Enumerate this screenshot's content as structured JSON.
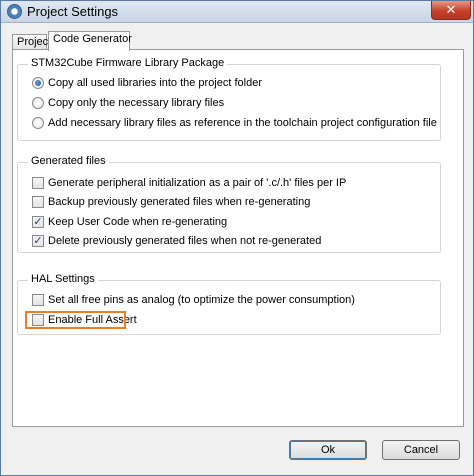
{
  "window": {
    "title": "Project Settings",
    "close_glyph": "✕"
  },
  "tabs": [
    {
      "label": "Project",
      "active": false
    },
    {
      "label": "Code Generator",
      "active": true
    }
  ],
  "firmware_group": {
    "title": "STM32Cube Firmware Library Package",
    "options": [
      {
        "label": "Copy all used libraries into the project folder",
        "selected": true
      },
      {
        "label": "Copy only the necessary library files",
        "selected": false
      },
      {
        "label": "Add necessary library files as reference in the toolchain project configuration file",
        "selected": false
      }
    ]
  },
  "generated_group": {
    "title": "Generated files",
    "options": [
      {
        "label": "Generate peripheral initialization as a pair of '.c/.h' files per IP",
        "checked": false
      },
      {
        "label": "Backup previously generated files when re-generating",
        "checked": false
      },
      {
        "label": "Keep User Code when re-generating",
        "checked": true
      },
      {
        "label": "Delete previously generated files when not re-generated",
        "checked": true
      }
    ]
  },
  "hal_group": {
    "title": "HAL Settings",
    "options": [
      {
        "label": "Set all free pins as analog (to optimize the power consumption)",
        "checked": false
      },
      {
        "label": "Enable Full Assert",
        "checked": false
      }
    ]
  },
  "buttons": {
    "ok": "Ok",
    "cancel": "Cancel"
  },
  "check_glyph": "✓",
  "colors": {
    "highlight": "#ef7d22",
    "close_button": "#c7412a"
  }
}
